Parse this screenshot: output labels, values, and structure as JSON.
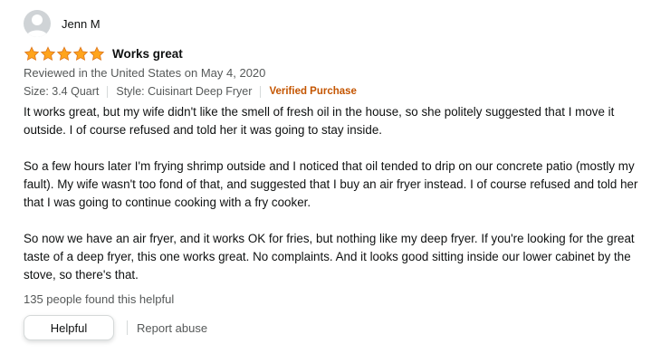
{
  "reviewer": {
    "name": "Jenn M",
    "avatar_icon": "person-silhouette-icon"
  },
  "rating": {
    "stars": 5,
    "out_of": 5,
    "star_color": "#ffa41c"
  },
  "title": "Works great",
  "reviewed_line": "Reviewed in the United States on May 4, 2020",
  "variant": {
    "size": "Size: 3.4 Quart",
    "style": "Style: Cuisinart Deep Fryer",
    "verified": "Verified Purchase",
    "verified_color": "#c45500"
  },
  "body": {
    "p1": "It works great, but my wife didn't like the smell of fresh oil in the house, so she politely suggested that I move it outside. I of course refused and told her it was going to stay inside.",
    "p2": "So a few hours later I'm frying shrimp outside and I noticed that oil tended to drip on our concrete patio (mostly my fault). My wife wasn't too fond of that, and suggested that I buy an air fryer instead. I of course refused and told her that I was going to continue cooking with a fry cooker.",
    "p3": "So now we have an air fryer, and it works OK for fries, but nothing like my deep fryer. If you're looking for the great taste of a deep fryer, this one works great. No complaints. And it looks good sitting inside our lower cabinet by the stove, so there's that."
  },
  "helpful_count": "135 people found this helpful",
  "actions": {
    "helpful": "Helpful",
    "report": "Report abuse"
  }
}
